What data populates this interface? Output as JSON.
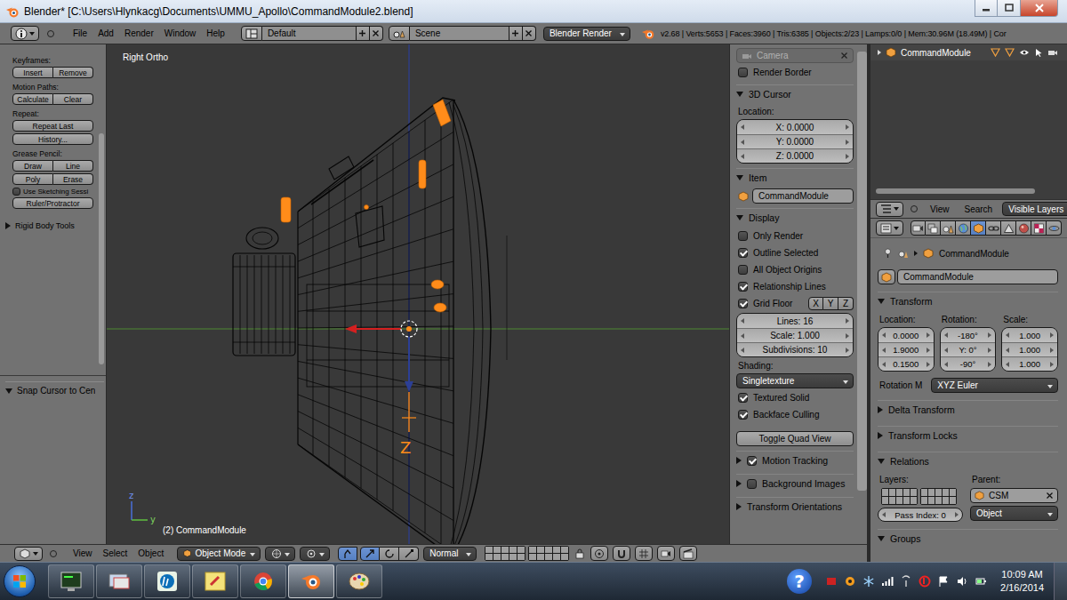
{
  "window": {
    "title": "Blender* [C:\\Users\\Hlynkacg\\Documents\\UMMU_Apollo\\CommandModule2.blend]"
  },
  "info_header": {
    "menus": [
      "File",
      "Add",
      "Render",
      "Window",
      "Help"
    ],
    "layout": "Default",
    "scene": "Scene",
    "engine": "Blender Render",
    "stats": "v2.68 | Verts:5653 | Faces:3960 | Tris:6385 | Objects:2/23 | Lamps:0/0 | Mem:30.96M (18.49M) | Cor"
  },
  "tool_shelf": {
    "rows": [
      {
        "kind": "label",
        "text": "Keyframes:"
      },
      {
        "kind": "pair",
        "buttons": [
          "Insert",
          "Remove"
        ]
      },
      {
        "kind": "label",
        "text": "Motion Paths:"
      },
      {
        "kind": "pair",
        "buttons": [
          "Calculate",
          "Clear"
        ]
      },
      {
        "kind": "label",
        "text": "Repeat:"
      },
      {
        "kind": "button",
        "text": "Repeat Last"
      },
      {
        "kind": "button",
        "text": "History..."
      },
      {
        "kind": "label",
        "text": "Grease Pencil:"
      },
      {
        "kind": "pair",
        "buttons": [
          "Draw",
          "Line"
        ]
      },
      {
        "kind": "pair",
        "buttons": [
          "Poly",
          "Erase"
        ]
      },
      {
        "kind": "checkbox",
        "text": "Use Sketching Sessi",
        "checked": false
      },
      {
        "kind": "button",
        "text": "Ruler/Protractor"
      },
      {
        "kind": "panel",
        "text": "Rigid Body Tools",
        "expanded": false
      }
    ],
    "operator_panel": {
      "title": "Snap Cursor to Cen",
      "expanded": true
    }
  },
  "viewport": {
    "view_name": "Right Ortho",
    "object_label": "(2) CommandModule",
    "axis_label": "Z",
    "gizmo_labels": [
      "z",
      "y"
    ]
  },
  "n_panel": {
    "camera": {
      "label": "Camera",
      "disabled": true
    },
    "render_border": {
      "label": "Render Border",
      "checked": false
    },
    "cursor": {
      "title": "3D Cursor",
      "expanded": true,
      "location_label": "Location:",
      "fields": [
        "X: 0.0000",
        "Y: 0.0000",
        "Z: 0.0000"
      ]
    },
    "item": {
      "title": "Item",
      "expanded": true,
      "name": "CommandModule"
    },
    "display": {
      "title": "Display",
      "expanded": true,
      "options": [
        {
          "label": "Only Render",
          "checked": false
        },
        {
          "label": "Outline Selected",
          "checked": true
        },
        {
          "label": "All Object Origins",
          "checked": false
        },
        {
          "label": "Relationship Lines",
          "checked": true
        }
      ],
      "grid_floor": {
        "label": "Grid Floor",
        "checked": true,
        "axes": [
          {
            "label": "X",
            "selected": false
          },
          {
            "label": "Y",
            "selected": false
          },
          {
            "label": "Z",
            "selected": false
          }
        ]
      },
      "grid_fields": [
        "Lines: 16",
        "Scale: 1.000",
        "Subdivisions: 10"
      ],
      "shading_label": "Shading:",
      "shading": "Singletexture",
      "shading_options": [
        {
          "label": "Textured Solid",
          "checked": true
        },
        {
          "label": "Backface Culling",
          "checked": true
        }
      ],
      "button": "Toggle Quad View"
    },
    "collapsed": [
      {
        "title": "Motion Tracking",
        "kind": "toggle",
        "checked": true,
        "expanded": false
      },
      {
        "title": "Background Images",
        "kind": "toggle",
        "checked": false,
        "expanded": false
      },
      {
        "title": "Transform Orientations",
        "kind": "plain",
        "expanded": false
      }
    ]
  },
  "outliner": {
    "items": [
      {
        "name": "CommandModule",
        "selected": false
      }
    ],
    "menus": [
      "View",
      "Search"
    ],
    "filter": "Visible Layers"
  },
  "properties": {
    "tabs": [
      {
        "kind": "render",
        "selected": false
      },
      {
        "kind": "layers",
        "selected": false
      },
      {
        "kind": "scene",
        "selected": false
      },
      {
        "kind": "world",
        "selected": false
      },
      {
        "kind": "object",
        "selected": true
      },
      {
        "kind": "constraints",
        "selected": false
      },
      {
        "kind": "data",
        "selected": false
      },
      {
        "kind": "material",
        "selected": false
      },
      {
        "kind": "texture",
        "selected": false
      },
      {
        "kind": "physics",
        "selected": false
      }
    ],
    "breadcrumb": "CommandModule",
    "name": "CommandModule",
    "transform": {
      "title": "Transform",
      "expanded": true,
      "columns": [
        {
          "label": "Location:",
          "values": [
            "0.0000",
            "1.9000",
            "0.1500"
          ]
        },
        {
          "label": "Rotation:",
          "values": [
            "-180°",
            "Y: 0°",
            "-90°"
          ]
        },
        {
          "label": "Scale:",
          "values": [
            "1.000",
            "1.000",
            "1.000"
          ]
        }
      ],
      "rotation_mode_label": "Rotation M",
      "rotation_mode": "XYZ Euler"
    },
    "collapsed": [
      {
        "title": "Delta Transform",
        "expanded": false
      },
      {
        "title": "Transform Locks",
        "expanded": false
      }
    ],
    "relations": {
      "title": "Relations",
      "expanded": true,
      "layers_label": "Layers:",
      "parent_label": "Parent:",
      "parent": "CSM",
      "parent_type": "Object",
      "pass_index": "Pass Index: 0"
    },
    "groups": {
      "title": "Groups",
      "expanded": true
    }
  },
  "view3d_header": {
    "menus": [
      "View",
      "Select",
      "Object"
    ],
    "mode": "Object Mode",
    "orientation": "Normal",
    "tools": [
      {
        "kind": "manipulator",
        "selected": true
      },
      {
        "kind": "translate",
        "selected": true
      },
      {
        "kind": "rotate",
        "selected": false
      },
      {
        "kind": "scale",
        "selected": false
      }
    ]
  },
  "taskbar": {
    "apps": [
      {
        "kind": "terminal",
        "selected": false
      },
      {
        "kind": "remote",
        "selected": false
      },
      {
        "kind": "hp",
        "selected": false
      },
      {
        "kind": "paint",
        "selected": false
      },
      {
        "kind": "chrome",
        "selected": false
      },
      {
        "kind": "blender",
        "selected": true
      },
      {
        "kind": "palette",
        "selected": false
      }
    ],
    "help": "?",
    "time": "10:09 AM",
    "date": "2/16/2014"
  }
}
